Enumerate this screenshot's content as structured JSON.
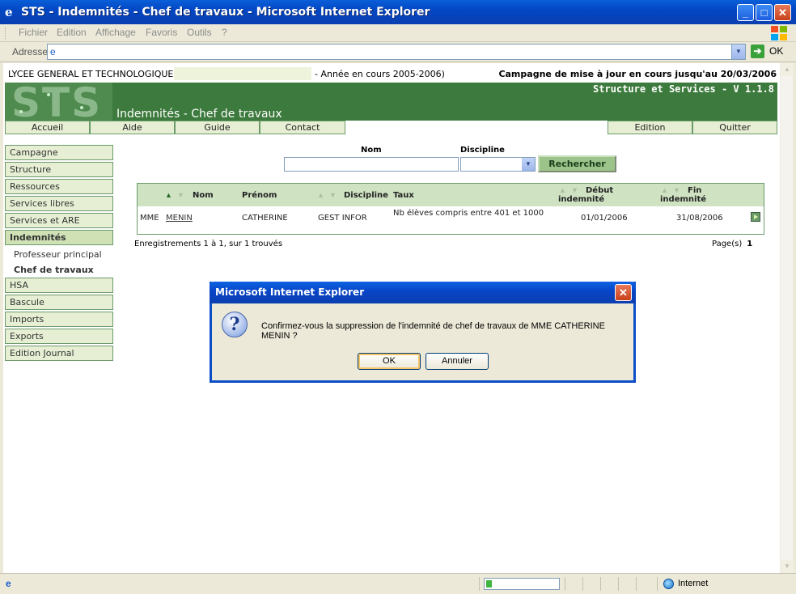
{
  "window": {
    "title": "STS - Indemnités - Chef de travaux - Microsoft Internet Explorer",
    "minimize": "_",
    "maximize": "□",
    "close": "✕"
  },
  "menu": [
    "Fichier",
    "Edition",
    "Affichage",
    "Favoris",
    "Outils",
    "?"
  ],
  "address": {
    "label": "Adresse",
    "value": "",
    "go_label": "OK"
  },
  "info": {
    "school": "LYCEE GENERAL ET TECHNOLOGIQUE",
    "year": "- Année en cours 2005-2006)",
    "campagne": "Campagne de mise à jour en cours jusqu'au 20/03/2006"
  },
  "banner": {
    "logo_text": "STS",
    "version": "Structure et Services - V 1.1.8",
    "page_title": "Indemnités - Chef de travaux"
  },
  "tabs": {
    "left": [
      "Accueil",
      "Aide",
      "Guide",
      "Contact"
    ],
    "right": [
      "Edition",
      "Quitter"
    ]
  },
  "sidebar": {
    "items": [
      "Campagne",
      "Structure",
      "Ressources",
      "Services libres",
      "Services et ARE",
      "Indemnités"
    ],
    "sub_items": [
      "Professeur principal",
      "Chef de travaux"
    ],
    "items_after": [
      "HSA",
      "Bascule",
      "Imports",
      "Exports",
      "Edition Journal"
    ]
  },
  "search": {
    "nom_label": "Nom",
    "nom_value": "",
    "discipline_label": "Discipline",
    "discipline_value": "",
    "button": "Rechercher"
  },
  "table": {
    "headers": {
      "nom": "Nom",
      "prenom": "Prénom",
      "discipline": "Discipline",
      "taux": "Taux",
      "debut": "Début indemnité",
      "fin": "Fin indemnité"
    },
    "rows": [
      {
        "civilite": "MME",
        "nom": "MENIN",
        "prenom": "CATHERINE",
        "discipline": "GEST INFOR",
        "taux": "Nb élèves compris entre 401 et 1000",
        "debut": "01/01/2006",
        "fin": "31/08/2006"
      }
    ]
  },
  "footer": {
    "records": "Enregistrements 1 à 1, sur 1 trouvés",
    "pages_label": "Page(s)",
    "page_num": "1"
  },
  "dialog": {
    "title": "Microsoft Internet Explorer",
    "message": "Confirmez-vous la suppression de l'indemnité de chef de travaux de MME CATHERINE MENIN ?",
    "ok": "OK",
    "cancel": "Annuler"
  },
  "status": {
    "zone": "Internet",
    "progress": 0.08
  }
}
